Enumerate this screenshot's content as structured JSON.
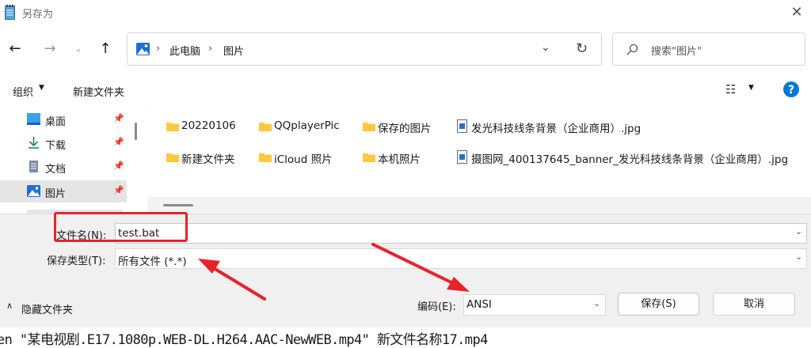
{
  "window": {
    "title": "另存为"
  },
  "navigation": {
    "breadcrumb": [
      "此电脑",
      "图片"
    ],
    "search_placeholder": "搜索\"图片\""
  },
  "toolbar": {
    "organize_label": "组织",
    "new_folder_label": "新建文件夹"
  },
  "sidebar": {
    "items": [
      {
        "label": "桌面",
        "icon": "desktop-icon",
        "selected": false
      },
      {
        "label": "下载",
        "icon": "download-icon",
        "selected": false
      },
      {
        "label": "文档",
        "icon": "document-icon",
        "selected": false
      },
      {
        "label": "图片",
        "icon": "pictures-icon",
        "selected": true
      }
    ]
  },
  "files": [
    {
      "name": "20220106",
      "type": "folder"
    },
    {
      "name": "QQplayerPic",
      "type": "folder"
    },
    {
      "name": "保存的图片",
      "type": "folder"
    },
    {
      "name": "发光科技线条背景（企业商用）.jpg",
      "type": "image"
    },
    {
      "name": "新建文件夹",
      "type": "folder"
    },
    {
      "name": "iCloud 照片",
      "type": "folder"
    },
    {
      "name": "本机照片",
      "type": "folder"
    },
    {
      "name": "摄图网_400137645_banner_发光科技线条背景（企业商用）.jpg",
      "type": "image"
    }
  ],
  "form": {
    "filename_label": "文件名(N):",
    "filename_value": "test.bat",
    "filetype_label": "保存类型(T):",
    "filetype_value": "所有文件 (*.*)",
    "encoding_label": "编码(E):",
    "encoding_value": "ANSI"
  },
  "buttons": {
    "hide_folders": "隐藏文件夹",
    "save": "保存(S)",
    "cancel": "取消"
  },
  "background_text": "en \"某电视剧.E17.1080p.WEB-DL.H264.AAC-NewWEB.mp4\" 新文件名称17.mp4",
  "colors": {
    "accent": "#0067c0",
    "folder": "#ffc83d",
    "annotation": "#e8232a",
    "help": "#0078d4"
  }
}
